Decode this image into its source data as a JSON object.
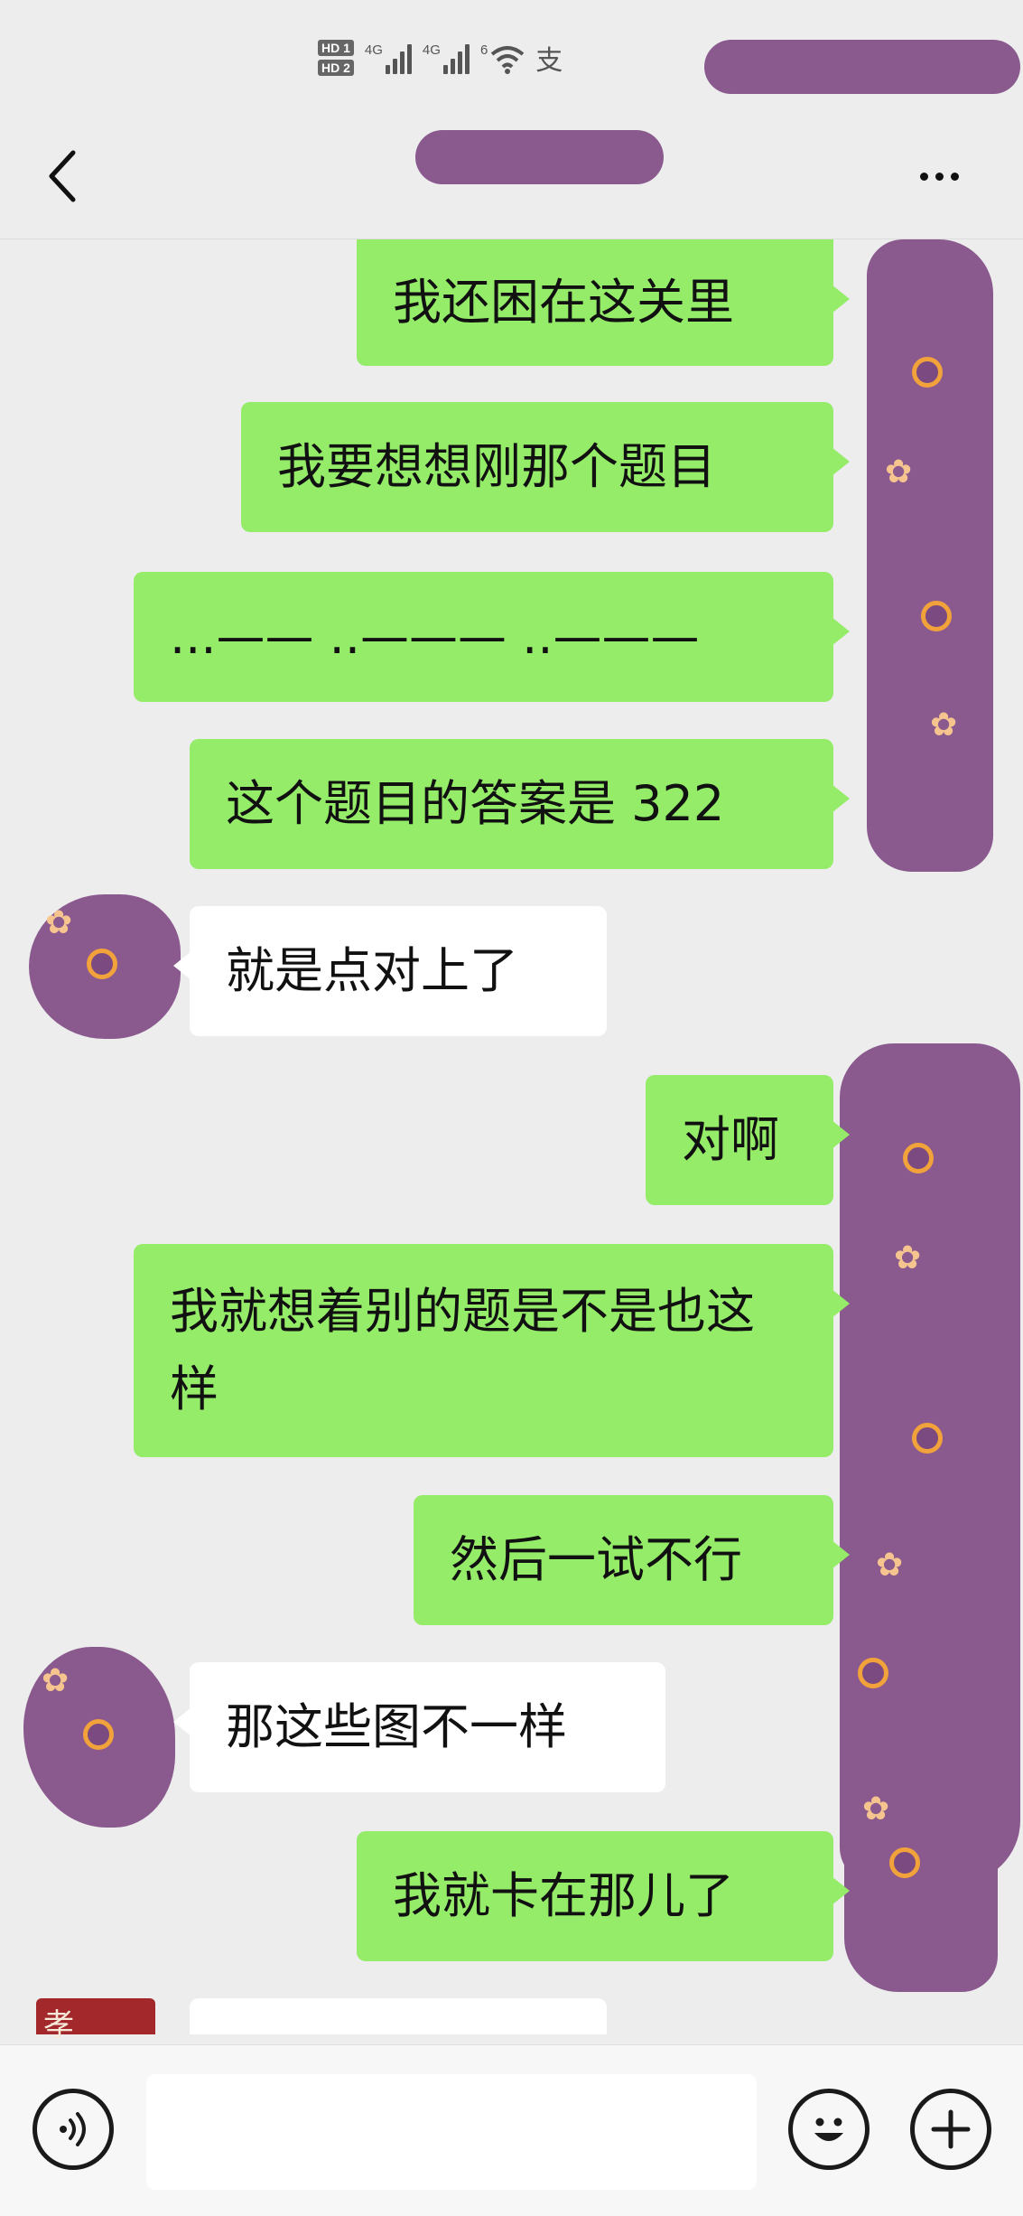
{
  "status_bar": {
    "hd_tags": [
      "HD 1",
      "HD 2"
    ],
    "networks": [
      "4G",
      "4G"
    ],
    "wifi_label": "6",
    "alipay_glyph": "支"
  },
  "nav": {
    "back_icon": "chevron-left-icon",
    "more_icon": "more-dots-icon",
    "title_masked": true
  },
  "messages": [
    {
      "direction": "out",
      "text": "我还困在这关里"
    },
    {
      "direction": "out",
      "text": "我要想想刚那个题目"
    },
    {
      "direction": "out",
      "text": "...—— ..——— ..———"
    },
    {
      "direction": "out",
      "text": "这个题目的答案是 322"
    },
    {
      "direction": "in",
      "text": "就是点对上了"
    },
    {
      "direction": "out",
      "text": "对啊"
    },
    {
      "direction": "out",
      "text": "我就想着别的题是不是也这样"
    },
    {
      "direction": "out",
      "text": "然后一试不行"
    },
    {
      "direction": "in",
      "text": "那这些图不一样"
    },
    {
      "direction": "out",
      "text": "我就卡在那儿了"
    }
  ],
  "input_bar": {
    "voice_icon": "voice-icon",
    "emoji_icon": "emoji-icon",
    "plus_icon": "plus-icon",
    "input_value": ""
  },
  "colors": {
    "outgoing_bubble": "#95ec69",
    "incoming_bubble": "#ffffff",
    "background": "#ededed",
    "privacy_mask": "#8a5a8e"
  }
}
